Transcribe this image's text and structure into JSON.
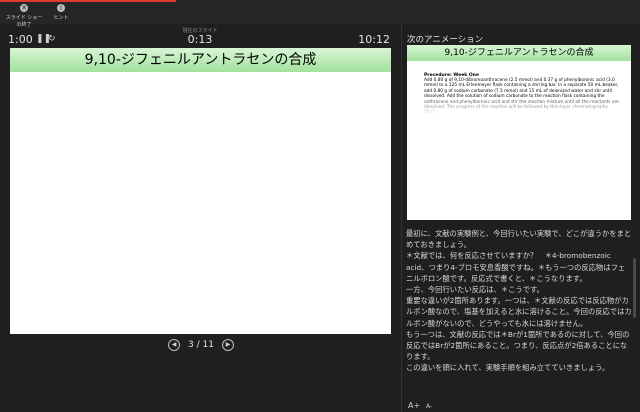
{
  "toolbar": {
    "exit_label": "スライド ショーの終了",
    "exit_icon": "close-icon",
    "hint_label": "ヒント",
    "hint_icon": "info-icon",
    "progress_color": "#e03a2f"
  },
  "presenter": {
    "timer": "1:00",
    "pause_icon": "pause-icon",
    "reset_icon": "reset-icon",
    "elapsed_label": "現在のスライド",
    "elapsed": "0:13",
    "clock": "10:12"
  },
  "slide": {
    "title": "9,10-ジフェニルアントラセンの合成",
    "accent": "#a2e19c"
  },
  "navigation": {
    "page": "3 / 11",
    "prev_icon": "prev-icon",
    "next_icon": "next-icon"
  },
  "next_panel": {
    "label": "次のアニメーション",
    "title": "9,10-ジフェニルアントラセンの合成",
    "heading": "Procedure: Week One",
    "body": "Add 0.80 g of 9,10-dibromoanthracene (2.5 mmol) and 0.37 g of phenylboronic acid (3.0 mmol) to a 125 mL Erlenmeyer flask containing a stirring bar. In a separate 50 mL beaker, add 0.80 g of sodium carbonate (7.5 mmol) and 15 mL of deionized water and stir until dissolved. Add the solution of sodium carbonate to the reaction flask containing the anthracene and phenylboronic acid and stir the reaction mixture until all the reactants are dissolved. The progress of the reaction will be followed by thin-layer chromatography (TLC)."
  },
  "notes": {
    "text": "最初に、文献の実験例と、今回行いたい実験で、どこが違うかをまとめておきましょう。\n＊文献では、何を反応させていますか？　＊4-bromobenzoic acid、つまり4-ブロモ安息香酸ですね。＊もう一つの反応物はフェニルボロン酸です。反応式で書くと、＊こうなります。\n一方、今回行いたい反応は、＊こうです。\n重要な違いが2箇所あります。一つは、＊文献の反応では反応物がカルボン酸なので、塩基を加えると水に溶けること。今回の反応ではカルボン酸がないので、どうやっても水には溶けません。\nもう一つは、文献の反応では＊Brが1箇所であるのに対して、今回の反応ではBrが2箇所にあること。つまり、反応点が2倍あることになります。\nこの違いを頭に入れて、実験手順を組み立てていきましょう。",
    "font_up": "A+",
    "font_down": "A-"
  }
}
